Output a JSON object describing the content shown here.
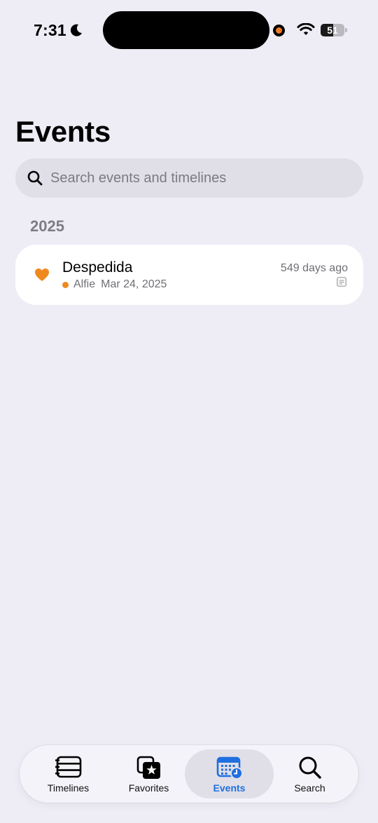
{
  "status_bar": {
    "time": "7:31",
    "battery_level": "51"
  },
  "page": {
    "title": "Events"
  },
  "search": {
    "placeholder": "Search events and timelines",
    "value": ""
  },
  "sections": [
    {
      "header": "2025",
      "events": [
        {
          "title": "Despedida",
          "person": "Alfie",
          "date": "Mar 24, 2025",
          "relative": "549 days ago",
          "icon": "heart-icon",
          "person_color": "#f0891d"
        }
      ]
    }
  ],
  "tab_bar": {
    "tabs": [
      {
        "label": "Timelines",
        "icon": "timelines-icon",
        "active": false
      },
      {
        "label": "Favorites",
        "icon": "favorites-icon",
        "active": false
      },
      {
        "label": "Events",
        "icon": "events-icon",
        "active": true
      },
      {
        "label": "Search",
        "icon": "search-icon",
        "active": false
      }
    ]
  },
  "colors": {
    "background": "#eeedf6",
    "accent": "#1f6fe0",
    "heart": "#f0891d"
  }
}
